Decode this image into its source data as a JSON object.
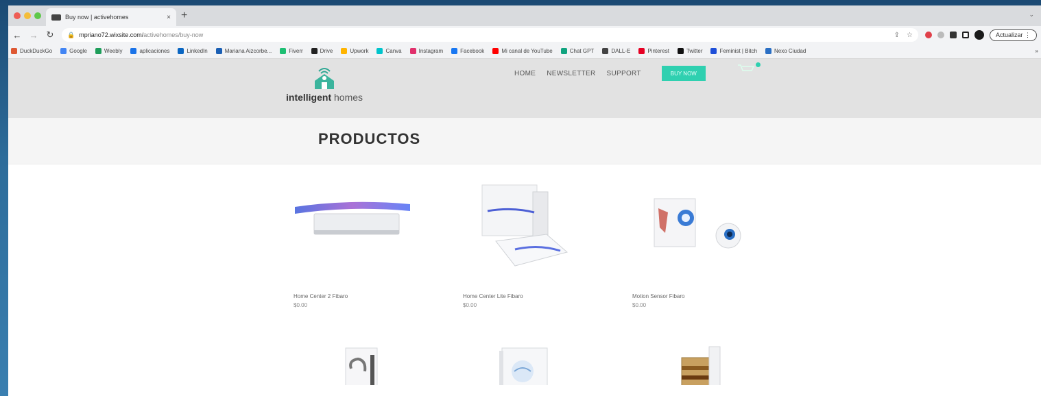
{
  "browser": {
    "tab_title": "Buy now | activehomes",
    "tab_close": "×",
    "new_tab": "+",
    "url_host": "mpriano72.wixsite.com/",
    "url_path": "activehomes/buy-now",
    "update_label": "Actualizar ⋮",
    "bookmarks": [
      "DuckDuckGo",
      "Google",
      "Weebly",
      "aplicaciones",
      "LinkedIn",
      "Mariana Aizcorbe...",
      "Fiverr",
      "Drive",
      "Upwork",
      "Canva",
      "Instagram",
      "Facebook",
      "Mi canal de YouTube",
      "Chat GPT",
      "DALL-E",
      "Pinterest",
      "Twitter",
      "Feminist | Bitch",
      "Nexo Ciudad"
    ]
  },
  "site": {
    "logo_bold": "intelligent",
    "logo_light": " homes",
    "menu": [
      "HOME",
      "NEWSLETTER",
      "SUPPORT"
    ],
    "cta_label": "BUY NOW",
    "page_title": "PRODUCTOS"
  },
  "products": [
    {
      "name": "Home Center 2 Fibaro",
      "price": "$0.00"
    },
    {
      "name": "Home Center Lite Fibaro",
      "price": "$0.00"
    },
    {
      "name": "Motion Sensor Fibaro",
      "price": "$0.00"
    }
  ],
  "colors": {
    "accent": "#2fd0b0",
    "header_bg": "#e2e2e2"
  }
}
